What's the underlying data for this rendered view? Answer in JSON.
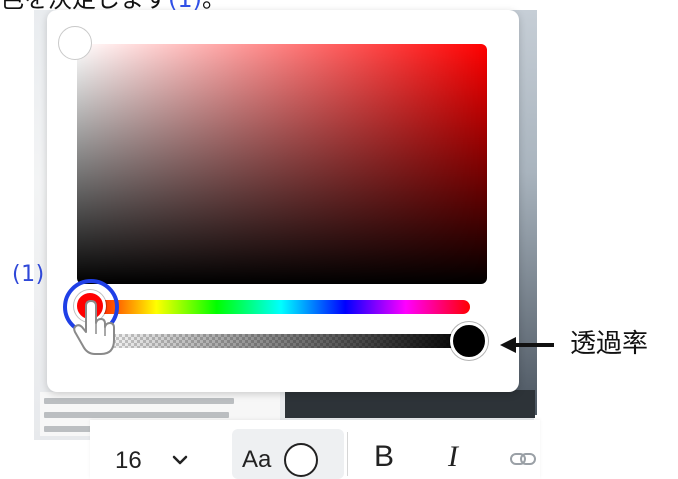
{
  "caption": {
    "text_before": "色を決定します",
    "step_ref": "(1)",
    "text_after": "。"
  },
  "color_picker": {
    "hue_color": "#ff0000",
    "accent_ring_color": "#1f3fe6",
    "icons": [
      "cursor-hand-icon",
      "arrow-left-icon"
    ]
  },
  "annotations": {
    "step_label": "(1)",
    "opacity_label": "透過率"
  },
  "toolbar": {
    "font_size": "16",
    "text_color_label": "Aa",
    "bold_label": "B",
    "italic_label": "I",
    "icons": [
      "chevron-down-icon",
      "text-color-circle-icon",
      "link-icon"
    ]
  }
}
